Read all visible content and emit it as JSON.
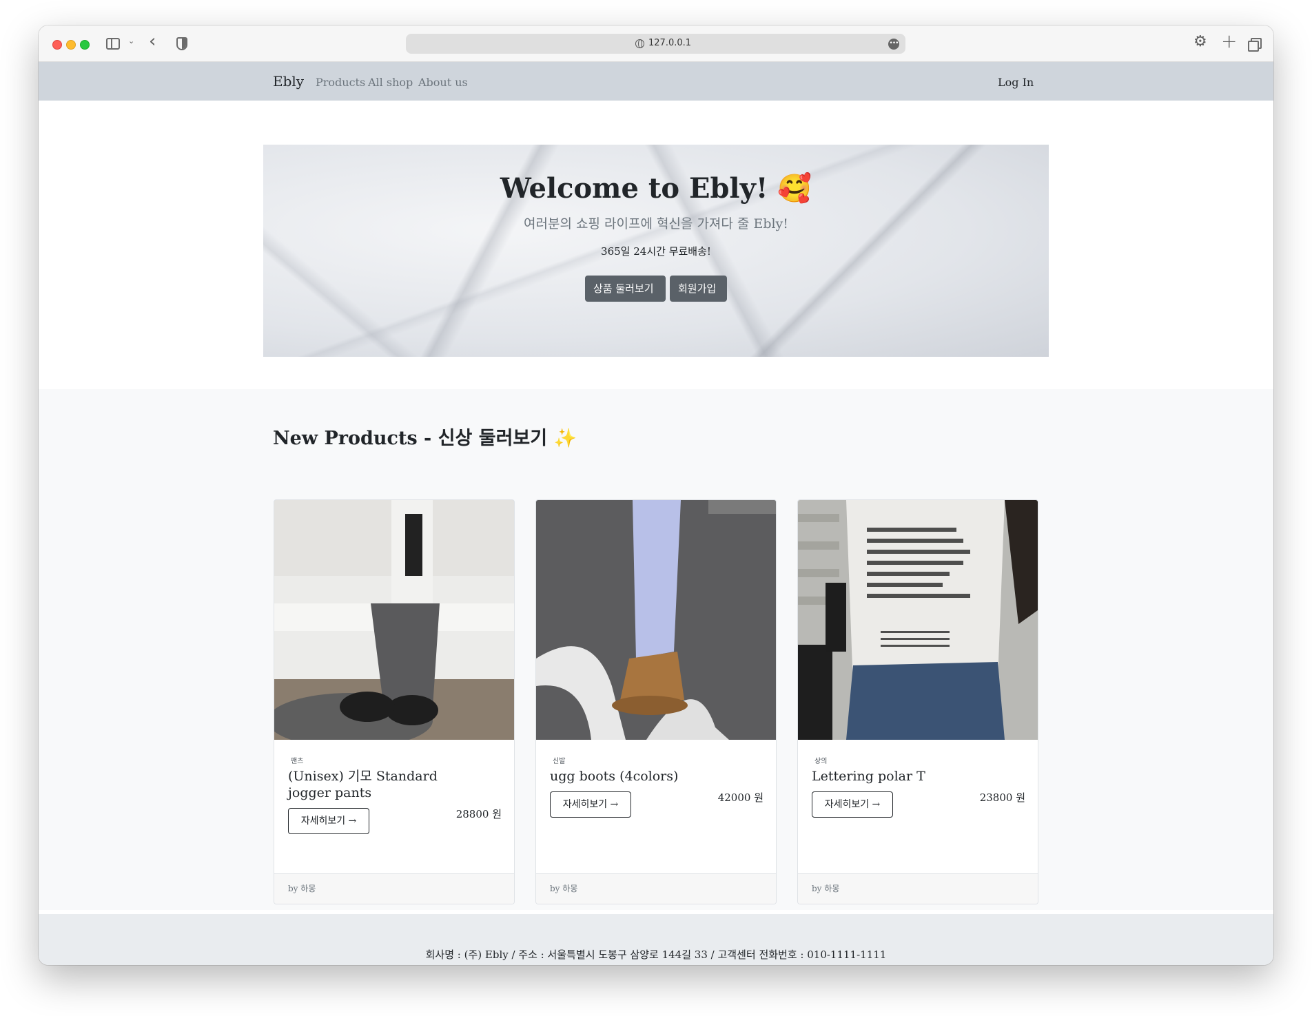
{
  "browser": {
    "url": "127.0.0.1"
  },
  "navbar": {
    "brand": "Ebly",
    "links": [
      "Products",
      "All shop",
      "About us"
    ],
    "login": "Log In"
  },
  "hero": {
    "title": "Welcome to Ebly! 🥰",
    "subtitle": "여러분의 쇼핑 라이프에 혁신을 가져다 줄 Ebly!",
    "note": "365일 24시간 무료배송!",
    "browse_button": "상품 둘러보기",
    "signup_button": "회원가입"
  },
  "products": {
    "title": "New Products - 신상 둘러보기 ✨",
    "items": [
      {
        "category": "팬츠",
        "name": "(Unisex) 기모 Standard jogger pants",
        "detail_button": "자세히보기 →",
        "price": "28800 원",
        "author": "by 하몽",
        "image_icon": "jogger-pants-photo"
      },
      {
        "category": "신발",
        "name": "ugg boots (4colors)",
        "detail_button": "자세히보기 →",
        "price": "42000 원",
        "author": "by 하몽",
        "image_icon": "ugg-boots-photo"
      },
      {
        "category": "상의",
        "name": "Lettering polar T",
        "detail_button": "자세히보기 →",
        "price": "23800 원",
        "author": "by 하몽",
        "image_icon": "lettering-tee-photo"
      }
    ]
  },
  "footer": {
    "text": "회사명 : (주) Ebly / 주소 : 서울특별시 도봉구 삼양로 144길 33 / 고객센터 전화번호 : 010-1111-1111"
  },
  "colors": {
    "navbar_bg": "#cfd5dc",
    "hero_button": "#5a6168",
    "section_bg": "#f8f9fa",
    "footer_bg": "#e9ecef"
  }
}
